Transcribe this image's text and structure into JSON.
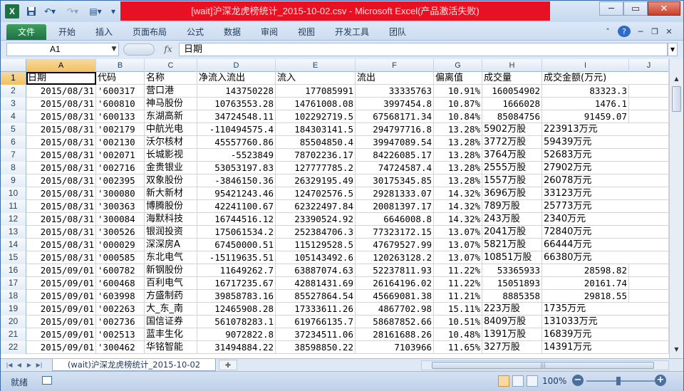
{
  "title": "[wait]沪深龙虎榜统计_2015-10-02.csv - Microsoft Excel(产品激活失败)",
  "ribbon": {
    "tabs": [
      "文件",
      "开始",
      "插入",
      "页面布局",
      "公式",
      "数据",
      "审阅",
      "视图",
      "开发工具",
      "团队"
    ]
  },
  "formula_bar": {
    "name_box": "A1",
    "fx_label": "fx",
    "content": "日期"
  },
  "grid": {
    "columns": [
      "A",
      "B",
      "C",
      "D",
      "E",
      "F",
      "G",
      "H",
      "I",
      "J"
    ],
    "selected_column": "A",
    "selected_row": "1",
    "rows": [
      {
        "n": "1",
        "cells": [
          "日期",
          "代码",
          "名称",
          "净流入流出",
          "流入",
          "流出",
          "偏离值",
          "成交量",
          "成交金额(万元)",
          ""
        ]
      },
      {
        "n": "2",
        "cells": [
          "2015/08/31",
          "'600317",
          "营口港",
          "143750228",
          "177085991",
          "33335763",
          "10.91%",
          "160054902",
          "83323.3",
          ""
        ]
      },
      {
        "n": "3",
        "cells": [
          "2015/08/31",
          "'600810",
          "神马股份",
          "10763553.28",
          "14761008.08",
          "3997454.8",
          "10.87%",
          "1666028",
          "1476.1",
          ""
        ]
      },
      {
        "n": "4",
        "cells": [
          "2015/08/31",
          "'600133",
          "东湖高新",
          "34724548.11",
          "102292719.5",
          "67568171.34",
          "10.84%",
          "85084756",
          "91459.07",
          ""
        ]
      },
      {
        "n": "5",
        "cells": [
          "2015/08/31",
          "'002179",
          "中航光电",
          "-110494575.4",
          "184303141.5",
          "294797716.8",
          "13.28%",
          "5902万股",
          "223913万元",
          ""
        ]
      },
      {
        "n": "6",
        "cells": [
          "2015/08/31",
          "'002130",
          "沃尔核材",
          "45557760.86",
          "85504850.4",
          "39947089.54",
          "13.28%",
          "3772万股",
          "59439万元",
          ""
        ]
      },
      {
        "n": "7",
        "cells": [
          "2015/08/31",
          "'002071",
          "长城影视",
          "-5523849",
          "78702236.17",
          "84226085.17",
          "13.28%",
          "3764万股",
          "52683万元",
          ""
        ]
      },
      {
        "n": "8",
        "cells": [
          "2015/08/31",
          "'002716",
          "金贵银业",
          "53053197.83",
          "127777785.2",
          "74724587.4",
          "13.28%",
          "2555万股",
          "27902万元",
          ""
        ]
      },
      {
        "n": "9",
        "cells": [
          "2015/08/31",
          "'002395",
          "双象股份",
          "-3846150.36",
          "26329195.49",
          "30175345.85",
          "13.28%",
          "1557万股",
          "26078万元",
          ""
        ]
      },
      {
        "n": "10",
        "cells": [
          "2015/08/31",
          "'300080",
          "新大新材",
          "95421243.46",
          "124702576.5",
          "29281333.07",
          "14.32%",
          "3696万股",
          "33123万元",
          ""
        ]
      },
      {
        "n": "11",
        "cells": [
          "2015/08/31",
          "'300363",
          "博腾股份",
          "42241100.67",
          "62322497.84",
          "20081397.17",
          "14.32%",
          "789万股",
          "25773万元",
          ""
        ]
      },
      {
        "n": "12",
        "cells": [
          "2015/08/31",
          "'300084",
          "海默科技",
          "16744516.12",
          "23390524.92",
          "6646008.8",
          "14.32%",
          "243万股",
          "2340万元",
          ""
        ]
      },
      {
        "n": "13",
        "cells": [
          "2015/08/31",
          "'300526",
          "银润投资",
          "175061534.2",
          "252384706.3",
          "77323172.15",
          "13.07%",
          "2041万股",
          "72840万元",
          ""
        ]
      },
      {
        "n": "14",
        "cells": [
          "2015/08/31",
          "'000029",
          "深深房A",
          "67450000.51",
          "115129528.5",
          "47679527.99",
          "13.07%",
          "5821万股",
          "66444万元",
          ""
        ]
      },
      {
        "n": "15",
        "cells": [
          "2015/08/31",
          "'000585",
          "东北电气",
          "-15119635.51",
          "105143492.6",
          "120263128.2",
          "13.07%",
          "10851万股",
          "66380万元",
          ""
        ]
      },
      {
        "n": "16",
        "cells": [
          "2015/09/01",
          "'600782",
          "新钢股份",
          "11649262.7",
          "63887074.63",
          "52237811.93",
          "11.22%",
          "53365933",
          "28598.82",
          ""
        ]
      },
      {
        "n": "17",
        "cells": [
          "2015/09/01",
          "'600468",
          "百利电气",
          "16717235.67",
          "42881431.69",
          "26164196.02",
          "11.22%",
          "15051893",
          "20161.74",
          ""
        ]
      },
      {
        "n": "18",
        "cells": [
          "2015/09/01",
          "'603998",
          "方盛制药",
          "39858783.16",
          "85527864.54",
          "45669081.38",
          "11.21%",
          "8885358",
          "29818.55",
          ""
        ]
      },
      {
        "n": "19",
        "cells": [
          "2015/09/01",
          "'002263",
          "大_东_南",
          "12465908.28",
          "17333611.26",
          "4867702.98",
          "15.11%",
          "223万股",
          "1735万元",
          ""
        ]
      },
      {
        "n": "20",
        "cells": [
          "2015/09/01",
          "'002736",
          "国信证券",
          "561078283.1",
          "619766135.7",
          "58687852.66",
          "10.51%",
          "8409万股",
          "131033万元",
          ""
        ]
      },
      {
        "n": "21",
        "cells": [
          "2015/09/01",
          "'002513",
          "蓝丰生化",
          "9072822.8",
          "37234511.06",
          "28161688.26",
          "10.48%",
          "1391万股",
          "16839万元",
          ""
        ]
      },
      {
        "n": "22",
        "cells": [
          "2015/09/01",
          "'300462",
          "华铭智能",
          "31494884.22",
          "38598850.22",
          "7103966",
          "11.65%",
          "327万股",
          "14391万元",
          ""
        ]
      }
    ]
  },
  "sheet_tabs": {
    "active": "(wait)沪深龙虎榜统计_2015-10-02"
  },
  "status": {
    "ready": "就绪",
    "zoom": "100%"
  }
}
